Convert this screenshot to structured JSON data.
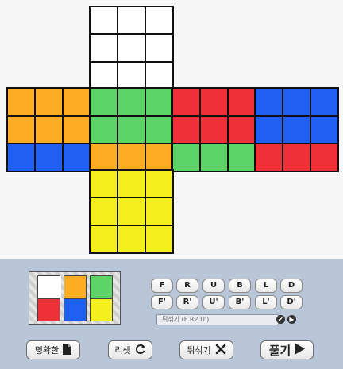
{
  "colors": {
    "white": "#ffffff",
    "orange": "#ffad24",
    "green": "#5cd466",
    "red": "#ee3136",
    "blue": "#1f5ff2",
    "yellow": "#f4f01e"
  },
  "cube": {
    "up": [
      "white",
      "white",
      "white",
      "white",
      "white",
      "white",
      "white",
      "white",
      "white"
    ],
    "left": [
      "orange",
      "orange",
      "orange",
      "orange",
      "orange",
      "orange",
      "blue",
      "blue",
      "blue"
    ],
    "front": [
      "green",
      "green",
      "green",
      "green",
      "green",
      "green",
      "orange",
      "orange",
      "orange"
    ],
    "right": [
      "red",
      "red",
      "red",
      "red",
      "red",
      "red",
      "green",
      "green",
      "green"
    ],
    "back": [
      "blue",
      "blue",
      "blue",
      "blue",
      "blue",
      "blue",
      "red",
      "red",
      "red"
    ],
    "down": [
      "yellow",
      "yellow",
      "yellow",
      "yellow",
      "yellow",
      "yellow",
      "yellow",
      "yellow",
      "yellow"
    ]
  },
  "palette": [
    "white",
    "orange",
    "green",
    "red",
    "blue",
    "yellow"
  ],
  "selected_color": "white",
  "moves": {
    "row1": [
      "F",
      "R",
      "U",
      "B",
      "L",
      "D"
    ],
    "row2": [
      "F'",
      "R'",
      "U'",
      "B'",
      "L'",
      "D'"
    ]
  },
  "scramble": {
    "placeholder": "뒤섞기 (F R2 U')"
  },
  "round_buttons": {
    "apply": "✔",
    "play": "▶"
  },
  "buttons": {
    "clear": "명확한",
    "reset": "리셋",
    "scramble": "뒤섞기",
    "solve": "풀기"
  },
  "icons": {
    "clear": "document-icon",
    "reset": "refresh-icon",
    "scramble": "shuffle-icon",
    "solve": "play-icon"
  }
}
